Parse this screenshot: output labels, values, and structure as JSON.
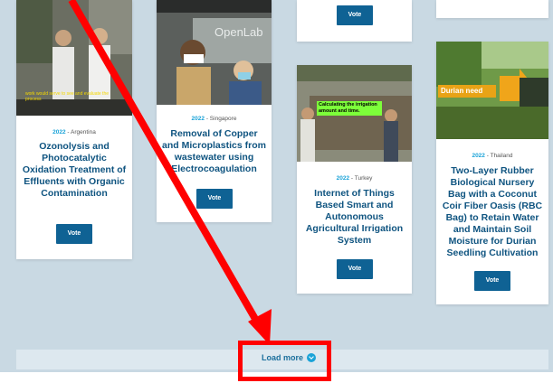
{
  "cards": [
    {
      "year": "2022",
      "country": "Argentina",
      "title": "Ozonolysis and Photocatalytic Oxidation Treatment of Effluents with Organic Contamination",
      "vote": "Vote",
      "caption": "work would serve to see and evaluate the process"
    },
    {
      "year": "2022",
      "country": "Singapore",
      "title": "Removal of Copper and Microplastics from wastewater using Electrocoagulation",
      "vote": "Vote",
      "caption": "OpenLab"
    },
    {
      "vote": "Vote"
    },
    {
      "year": "2022",
      "country": "Turkey",
      "title": "Internet of Things Based Smart and Autonomous Agricultural Irrigation System",
      "vote": "Vote",
      "caption": "Calculating the irrigation amount and time."
    },
    {
      "year": "2022",
      "country": "Thailand",
      "title": "Two-Layer Rubber Biological Nursery Bag with a Coconut Coir Fiber Oasis (RBC Bag) to Retain Water and Maintain Soil Moisture for Durian Seedling Cultivation",
      "vote": "Vote",
      "caption": "Durian need"
    }
  ],
  "load_more": "Load more",
  "separator": " - ",
  "colors": {
    "accent": "#1aa3d8",
    "title": "#0f5480",
    "button": "#0f6294",
    "annotation": "#ff0000"
  }
}
